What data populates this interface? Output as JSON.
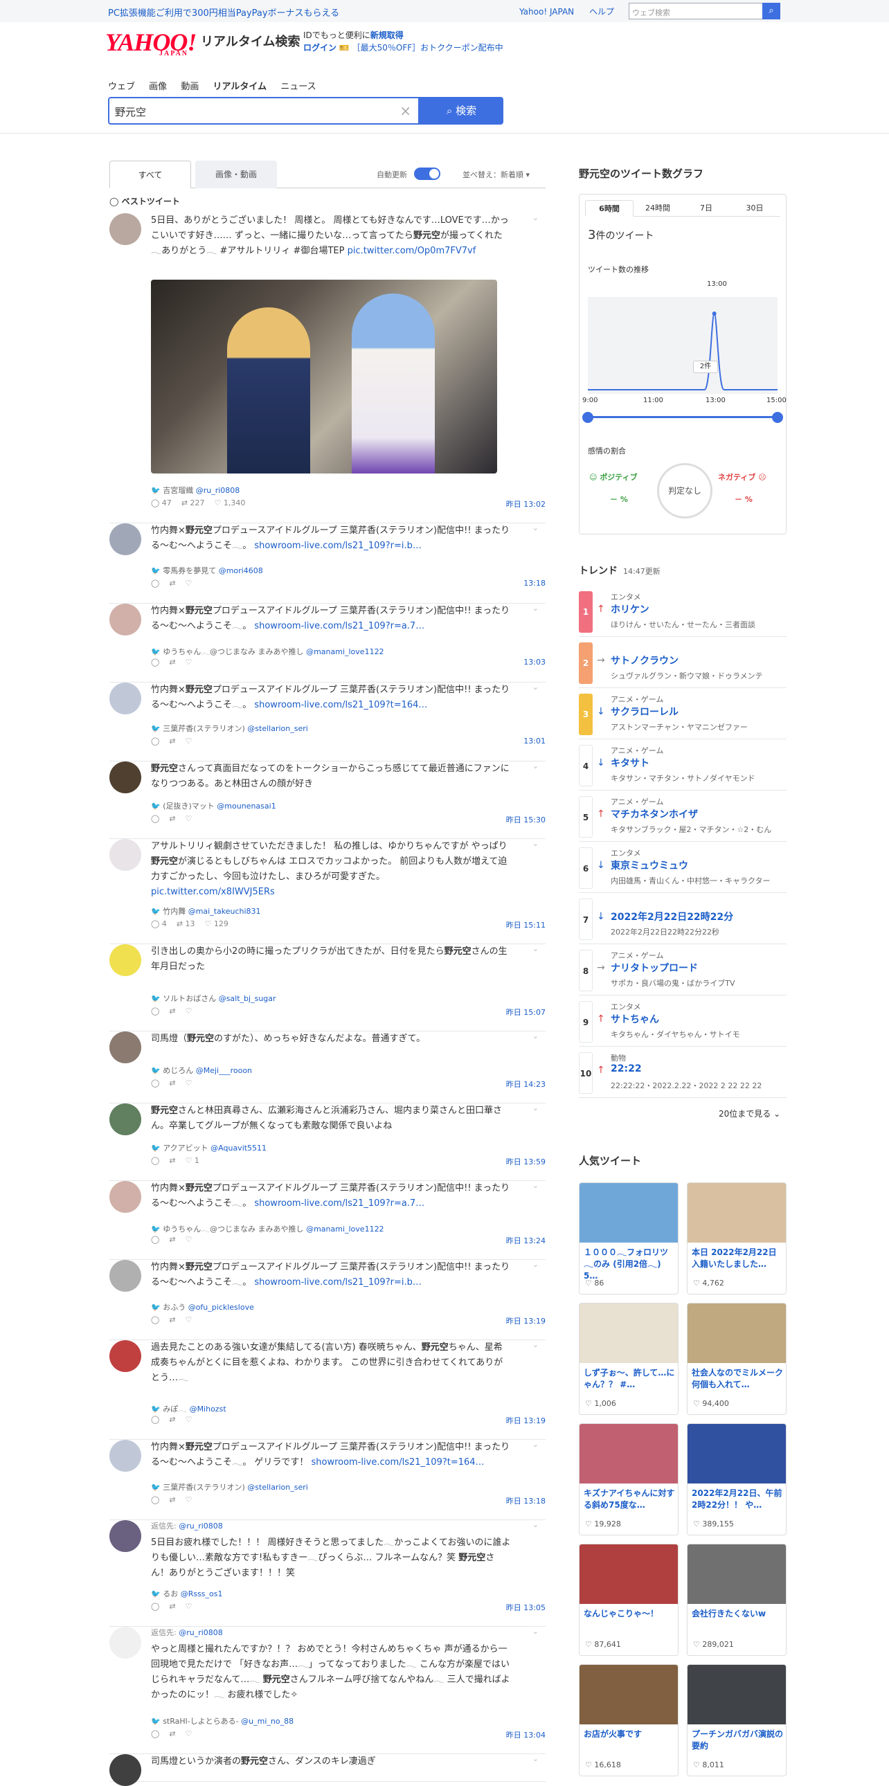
{
  "topbar": {
    "promo": "PC拡張機能ご利用で300円相当PayPayボーナスもらえる",
    "yahoo_japan": "Yahoo! JAPAN",
    "help": "ヘルプ",
    "web_search_placeholder": "ウェブ検索"
  },
  "header": {
    "logo": "YAHOO!",
    "logo_sub": "JAPAN",
    "brand": "リアルタイム検索",
    "id_promo": "IDでもっと便利に",
    "signup": "新規取得",
    "login": "ログイン",
    "coupon": "［最大50％OFF］おトククーポン配布中"
  },
  "nav": [
    "ウェブ",
    "画像",
    "動画",
    "リアルタイム",
    "ニュース"
  ],
  "search": {
    "value": "野元空",
    "button": "検索"
  },
  "left": {
    "tab_all": "すべて",
    "tab_media": "画像・動画",
    "auto_update": "自動更新",
    "sort": "並べ替え：新着順",
    "best": "ベストツイート"
  },
  "tweets": [
    {
      "text": "5日目、ありがとうございました！ 周様と。 周様とても好きなんです…LOVEです…かっこいいです好き…… ずっと、一緒に撮りたいな…って言ってたら野元空が撮ってくれた𓂃ありがとう𓂃 #アサルトリリィ #御台場TEP",
      "link": "pic.twitter.com/Op0m7FV7vf",
      "name": "吉宮瑠織",
      "handle": "@ru_ri0808",
      "replies": "47",
      "rts": "227",
      "likes": "1,340",
      "time": "昨日 13:02"
    },
    {
      "text": "竹内舞×野元空プロデュースアイドルグループ 三葉芹香(ステラリオン)配信中!! まったりる〜む〜へようこそ𓂃。",
      "link": "showroom-live.com/ls21_109?r=i.b…",
      "name": "零馬券を夢見て",
      "handle": "@mori4608",
      "time": "13:18"
    },
    {
      "text": "竹内舞×野元空プロデュースアイドルグループ 三葉芹香(ステラリオン)配信中!! まったりる〜む〜へようこそ𓂃。",
      "link": "showroom-live.com/ls21_109?r=a.7…",
      "name": "ゆうちゃん𓂃@つじまなみ まみあや推し",
      "handle": "@manami_love1122",
      "time": "13:03"
    },
    {
      "text": "竹内舞×野元空プロデュースアイドルグループ 三葉芹香(ステラリオン)配信中!! まったりる〜む〜へようこそ𓂃。",
      "link": "showroom-live.com/ls21_109?t=164…",
      "name": "三葉芹香(ステラリオン)",
      "handle": "@stellarion_seri",
      "time": "13:01"
    },
    {
      "text": "野元空さんって真面目だなってのをトークショーからこっち感じてて最近普通にファンになりつつある。あと林田さんの顔が好き",
      "name": "(足抜き)マット",
      "handle": "@mounenasai1",
      "time": "昨日 15:30"
    },
    {
      "text": "アサルトリリィ観劇させていただきました！ 私の推しは、ゆかりちゃんですが やっぱり野元空が演じるともしびちゃんは エロスでカッコよかった。 前回よりも人数が増えて迫力すごかったし、今回も泣けたし、まひろが可愛すぎた。",
      "link": "pic.twitter.com/x8IWVJ5ERs",
      "name": "竹内舞",
      "handle": "@mai_takeuchi831",
      "replies": "4",
      "rts": "13",
      "likes": "129",
      "time": "昨日 15:11"
    },
    {
      "text": "引き出しの奥から小2の時に撮ったプリクラが出てきたが、日付を見たら野元空さんの生年月日だった",
      "name": "ソルトおばさん",
      "handle": "@salt_bj_sugar",
      "time": "昨日 15:07"
    },
    {
      "text": "司馬燈（野元空のすがた）、めっちゃ好きなんだよな。普通すぎて。",
      "name": "めじろん",
      "handle": "@Meji___rooon",
      "time": "昨日 14:23"
    },
    {
      "text": "野元空さんと林田真尋さん、広瀬彩海さんと浜浦彩乃さん、堀内まり菜さんと田口華さん。卒業してグループが無くなっても素敵な関係で良いよね",
      "name": "アクアビット",
      "handle": "@Aquavit5511",
      "likes": "1",
      "time": "昨日 13:59"
    },
    {
      "text": "竹内舞×野元空プロデュースアイドルグループ 三葉芹香(ステラリオン)配信中!! まったりる〜む〜へようこそ𓂃。",
      "link": "showroom-live.com/ls21_109?r=a.7…",
      "name": "ゆうちゃん𓂃@つじまなみ まみあや推し",
      "handle": "@manami_love1122",
      "time": "昨日 13:24"
    },
    {
      "text": "竹内舞×野元空プロデュースアイドルグループ 三葉芹香(ステラリオン)配信中!! まったりる〜む〜へようこそ𓂃。",
      "link": "showroom-live.com/ls21_109?r=i.b…",
      "name": "おふう",
      "handle": "@ofu_pickleslove",
      "time": "昨日 13:19"
    },
    {
      "text": "過去見たことのある強い女達が集結してる(言い方) 春咲暁ちゃん、野元空ちゃん、星希成奏ちゃんがとくに目を惹くよね、わかります。 この世界に引き合わせてくれてありがとう…𓂃",
      "name": "みぽ𓂃",
      "handle": "@Mihozst",
      "time": "昨日 13:19"
    },
    {
      "text": "竹内舞×野元空プロデュースアイドルグループ 三葉芹香(ステラリオン)配信中!! まったりる〜む〜へようこそ𓂃。 ゲリラです！",
      "link": "showroom-live.com/ls21_109?t=164…",
      "name": "三葉芹香(ステラリオン)",
      "handle": "@stellarion_seri",
      "time": "昨日 13:18"
    },
    {
      "reply_to": "@ru_ri0808",
      "text": "5日目お疲れ様でした！！！ 周様好きそうと思ってました𓂃かっこよくてお強いのに誰よりも優しい…素敵な方です!私もすきー𓂃ぴっくらぶ… フルネームなん？笑 野元空さん！ありがとうございます！！！笑",
      "name": "るお",
      "handle": "@Rsss_os1",
      "time": "昨日 13:05",
      "reply_label": "返信先:"
    },
    {
      "reply_to": "@ru_ri0808",
      "text": "やっと周様と撮れたんですか？！？ おめでとう！今村さんめちゃくちゃ 声が通るから一回現地で見ただけで 「好きなお声…𓂃」ってなっておりました𓂃 こんな方が楽屋ではいじられキャラだなんて…𓂃 野元空さんフルネーム呼び捨てなんやねん𓂃 三人で撮ればよかったのにッ！𓂃 お疲れ様でした✧",
      "name": "stRaHl-しよとらある-",
      "handle": "@u_mi_no_88",
      "time": "昨日 13:04",
      "reply_label": "返信先:"
    },
    {
      "text": "司馬燈というか演者の野元空さん、ダンスのキレ凄過ぎ"
    }
  ],
  "graph": {
    "title": "野元空のツイート数グラフ",
    "tabs": [
      "6時間",
      "24時間",
      "7日",
      "30日"
    ],
    "count_num": "3",
    "count_suffix": "件のツイート",
    "trend_label": "ツイート数の推移",
    "peak_time": "13:00",
    "peak_value": "2件",
    "emotion_label": "感情の割合",
    "positive": "ポジティブ",
    "negative": "ネガティブ",
    "neutral": "判定なし",
    "pos_val": "－ %",
    "neg_val": "－ %"
  },
  "chart_data": {
    "type": "line",
    "x": [
      "9:00",
      "11:00",
      "13:00",
      "15:00"
    ],
    "peak": {
      "x": "13:00",
      "y": 2
    },
    "ylim": [
      0,
      2
    ]
  },
  "trend": {
    "title": "トレンド",
    "updated": "14:47更新",
    "more": "20位まで見る",
    "items": [
      {
        "rank": "1",
        "color": "#f07080",
        "cat": "エンタメ",
        "arrow": "↑",
        "kw": "ホリケン",
        "rel": "ほりけん・せいたん・せーたん・三者面談"
      },
      {
        "rank": "2",
        "color": "#f4a070",
        "cat": "",
        "arrow": "→",
        "kw": "サトノクラウン",
        "rel": "シュヴァルグラン・新ウマ娘・ドゥラメンテ"
      },
      {
        "rank": "3",
        "color": "#f4c040",
        "cat": "アニメ・ゲーム",
        "arrow": "↓",
        "kw": "サクラローレル",
        "rel": "アストンマーチャン・ヤマニンゼファー"
      },
      {
        "rank": "4",
        "color": "",
        "cat": "アニメ・ゲーム",
        "arrow": "↓",
        "kw": "キタサト",
        "rel": "キタサン・マチタン・サトノダイヤモンド"
      },
      {
        "rank": "5",
        "color": "",
        "cat": "アニメ・ゲーム",
        "arrow": "↑",
        "kw": "マチカネタンホイザ",
        "rel": "キタサンブラック・屋2・マチタン・☆2・むん"
      },
      {
        "rank": "6",
        "color": "",
        "cat": "エンタメ",
        "arrow": "↓",
        "kw": "東京ミュウミュウ",
        "rel": "内田雄馬・青山くん・中村悠一・キャラクター"
      },
      {
        "rank": "7",
        "color": "",
        "cat": "",
        "arrow": "↓",
        "kw": "2022年2月22日22時22分",
        "rel": "2022年2月22日22時22分22秒"
      },
      {
        "rank": "8",
        "color": "",
        "cat": "アニメ・ゲーム",
        "arrow": "→",
        "kw": "ナリタトップロード",
        "rel": "サポカ・良バ場の鬼・ばかライブTV"
      },
      {
        "rank": "9",
        "color": "",
        "cat": "エンタメ",
        "arrow": "↑",
        "kw": "サトちゃん",
        "rel": "キタちゃん・ダイヤちゃん・サトイモ"
      },
      {
        "rank": "10",
        "color": "",
        "cat": "動物",
        "arrow": "↑",
        "kw": "22:22",
        "rel": "22:22:22・2022.2.22・2022 2 22 22 22"
      }
    ]
  },
  "popular": {
    "title": "人気ツイート",
    "items": [
      {
        "cap": "１０００𓂃フォロリツ𓂃のみ (引用2倍𓂃) 5…",
        "likes": "86",
        "bg": "#6fa8d8"
      },
      {
        "cap": "本日 2022年2月22日 入籍いたしました…",
        "likes": "4,762",
        "bg": "#d8c0a0"
      },
      {
        "cap": "しず子ぉ〜、許して…にゃん？？ #…",
        "likes": "1,006",
        "bg": "#e8e0d0"
      },
      {
        "cap": "社会人なのでミルメーク何個も入れて…",
        "likes": "94,400",
        "bg": "#c0a880"
      },
      {
        "cap": "キズナアイちゃんに対する斜め75度な…",
        "likes": "19,928",
        "bg": "#c06070"
      },
      {
        "cap": "2022年2月22日、午前2時22分！！ や…",
        "likes": "389,155",
        "bg": "#3050a0"
      },
      {
        "cap": "なんじゃこりゃ〜！",
        "likes": "87,641",
        "bg": "#b04040"
      },
      {
        "cap": "会社行きたくないw",
        "likes": "289,021",
        "bg": "#707070"
      },
      {
        "cap": "お店が火事です",
        "likes": "16,618",
        "bg": "#806040"
      },
      {
        "cap": "プーチンガバガバ演説の要約",
        "likes": "8,011",
        "bg": "#404448"
      }
    ]
  }
}
